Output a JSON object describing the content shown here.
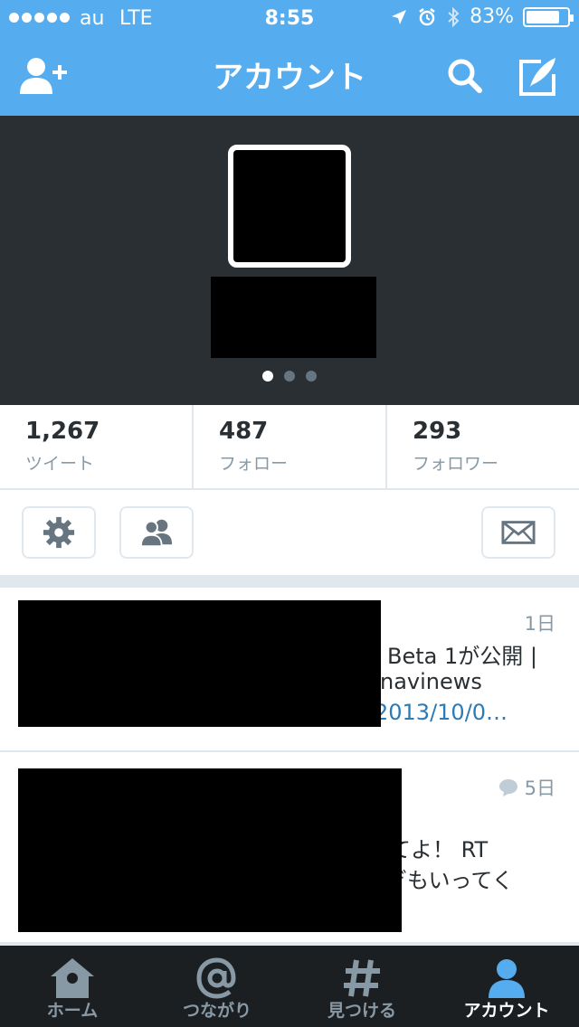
{
  "status": {
    "carrier": "au",
    "network": "LTE",
    "time": "8:55",
    "battery": "83%",
    "battery_level": 0.83
  },
  "nav": {
    "title": "アカウント"
  },
  "profile": {
    "page_dots": 3,
    "active_dot": 0
  },
  "stats": [
    {
      "value": "1,267",
      "label": "ツイート"
    },
    {
      "value": "487",
      "label": "フォロー"
    },
    {
      "value": "293",
      "label": "フォロワー"
    }
  ],
  "tweets": [
    {
      "time": "1日",
      "lines": [
        "Beta 1が公開 |",
        "navinews",
        "2013/10/0…"
      ]
    },
    {
      "time": "5日",
      "lines": [
        "てよ！ RT",
        "ぎもいってく"
      ]
    }
  ],
  "tabs": [
    {
      "label": "ホーム",
      "icon": "home-icon"
    },
    {
      "label": "つながり",
      "icon": "at-icon"
    },
    {
      "label": "見つける",
      "icon": "hash-icon"
    },
    {
      "label": "アカウント",
      "icon": "person-icon",
      "active": true
    }
  ],
  "colors": {
    "brand": "#55acee",
    "header_bg": "#292f33",
    "link": "#2b7bb9",
    "tabbar_bg": "#1c1f22"
  }
}
